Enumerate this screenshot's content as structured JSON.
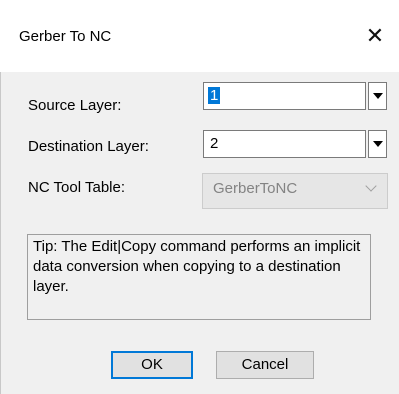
{
  "window": {
    "title": "Gerber To NC",
    "close_glyph": "✕"
  },
  "source_layer": {
    "label": "Source Layer:",
    "value": "1"
  },
  "destination_layer": {
    "label": "Destination Layer:",
    "value": "2"
  },
  "tool_table": {
    "label": "NC Tool Table:",
    "value": "GerberToNC",
    "enabled": false
  },
  "tip": {
    "text": "Tip: The Edit|Copy command performs an implicit data conversion when copying to a destination layer."
  },
  "buttons": {
    "ok_label": "OK",
    "cancel_label": "Cancel"
  },
  "colors": {
    "selection": "#0078d7",
    "default_button_border": "#0078d7",
    "dialog_bg": "#f0f0f0"
  }
}
